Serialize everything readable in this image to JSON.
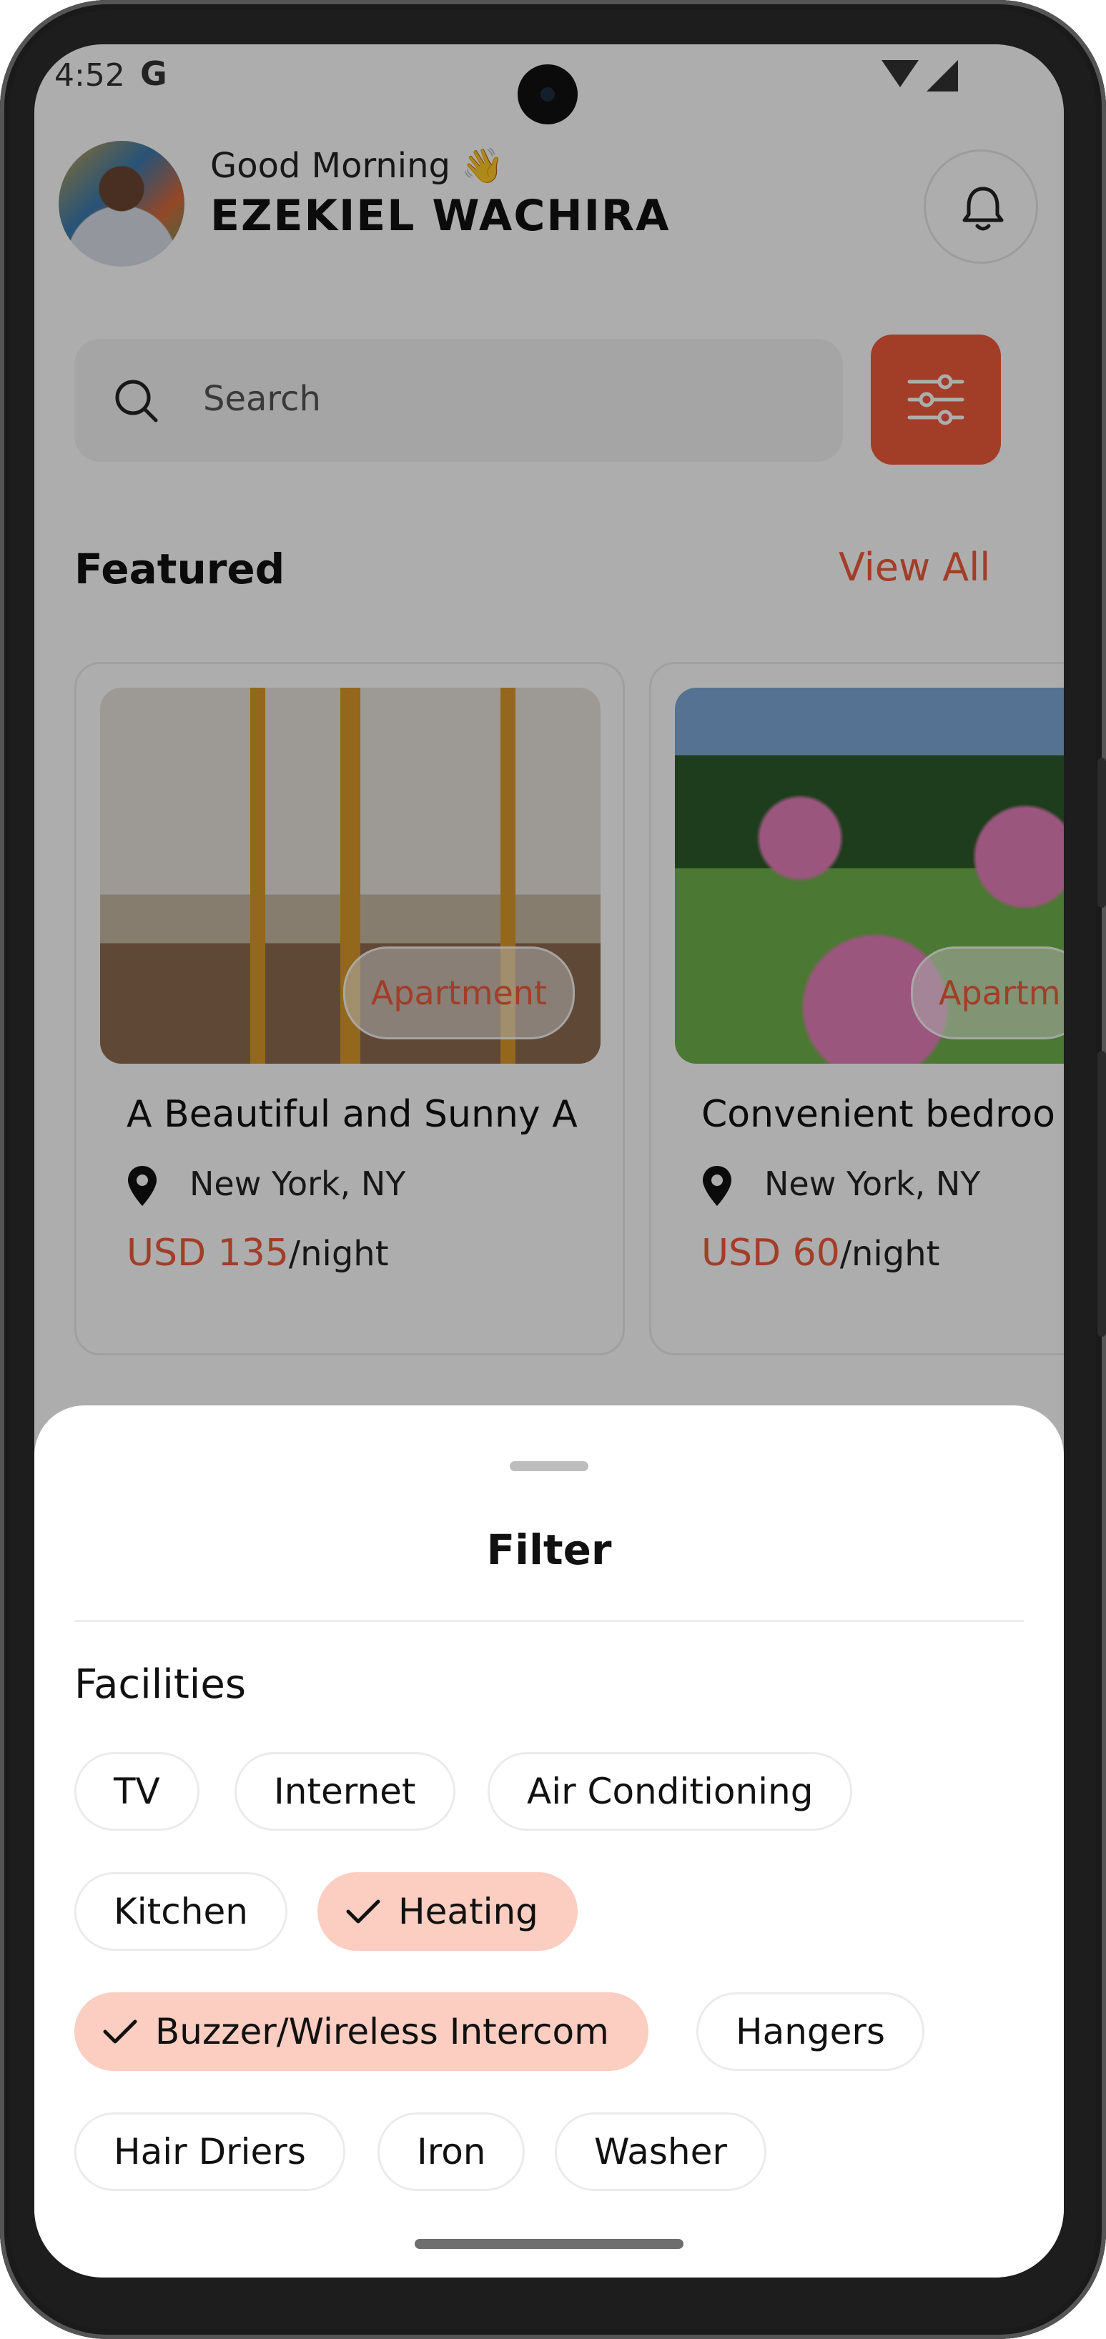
{
  "status_bar": {
    "time": "4:52",
    "g_label": "G"
  },
  "header": {
    "greeting": "Good Morning 👋",
    "username": "EZEKIEL WACHIRA"
  },
  "search": {
    "placeholder": "Search"
  },
  "featured": {
    "title": "Featured",
    "view_all": "View All",
    "cards": [
      {
        "badge": "Apartment",
        "title": "A Beautiful and Sunny A",
        "location": "New York, NY",
        "price": "USD 135",
        "unit": "/night"
      },
      {
        "badge": "Apartm",
        "title": "Convenient bedroo",
        "location": "New York, NY",
        "price": "USD 60",
        "unit": "/night"
      }
    ]
  },
  "filter_sheet": {
    "title": "Filter",
    "section": "Facilities",
    "chips": [
      {
        "label": "TV",
        "selected": false
      },
      {
        "label": "Internet",
        "selected": false
      },
      {
        "label": "Air Conditioning",
        "selected": false
      },
      {
        "label": "Kitchen",
        "selected": false
      },
      {
        "label": "Heating",
        "selected": true
      },
      {
        "label": "Buzzer/Wireless Intercom",
        "selected": true
      },
      {
        "label": "Hangers",
        "selected": false
      },
      {
        "label": "Hair Driers",
        "selected": false
      },
      {
        "label": "Iron",
        "selected": false
      },
      {
        "label": "Washer",
        "selected": false
      }
    ]
  },
  "colors": {
    "accent": "#ef5a3c",
    "selected_chip": "#fccdc1",
    "overlay": "rgba(0,0,0,0.32)"
  },
  "icons": [
    "search-icon",
    "bell-icon",
    "sliders-icon",
    "location-pin-icon",
    "check-icon",
    "wifi-icon",
    "signal-icon"
  ]
}
